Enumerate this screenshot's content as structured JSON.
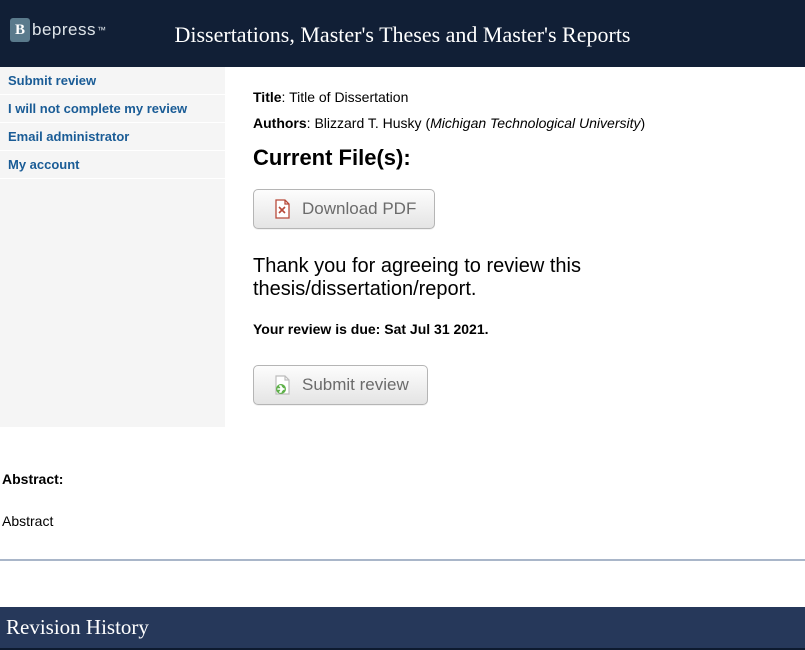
{
  "header": {
    "logo_letter": "B",
    "logo_text": "bepress",
    "logo_tm": "™",
    "title": "Dissertations, Master's Theses and Master's Reports"
  },
  "sidebar": {
    "items": [
      {
        "label": "Submit review"
      },
      {
        "label": "I will not complete my review"
      },
      {
        "label": "Email administrator"
      },
      {
        "label": "My account"
      }
    ]
  },
  "main": {
    "title_label": "Title",
    "title_value": "Title of Dissertation",
    "authors_label": "Authors",
    "author_name": "Blizzard T. Husky",
    "author_affiliation": "Michigan Technological University",
    "current_files_heading": "Current File(s):",
    "download_pdf_label": "Download PDF",
    "thank_you_text": "Thank you for agreeing to review this thesis/dissertation/report.",
    "due_prefix": "Your review is due: ",
    "due_date": "Sat Jul 31 2021",
    "due_suffix": ".",
    "submit_review_label": "Submit review"
  },
  "abstract": {
    "label": "Abstract:",
    "body": "Abstract"
  },
  "revision": {
    "heading": "Revision History"
  }
}
